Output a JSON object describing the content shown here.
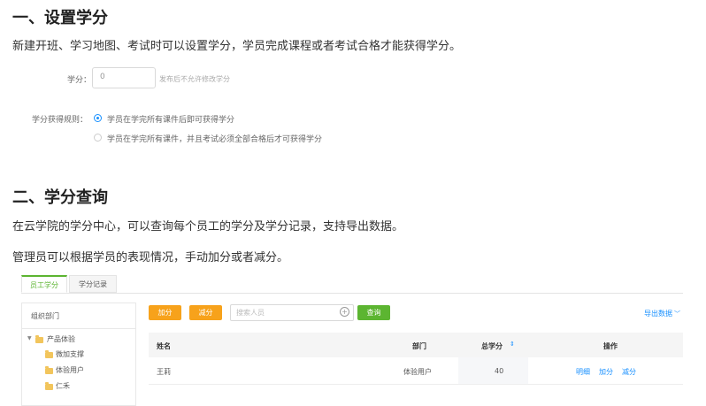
{
  "section1": {
    "title": "一、设置学分",
    "desc": "新建开班、学习地图、考试时可以设置学分，学员完成课程或者考试合格才能获得学分。",
    "credit_label": "学分：",
    "credit_value": "0",
    "credit_hint": "发布后不允许修改学分",
    "rule_label": "学分获得规则：",
    "rule_options": [
      "学员在学完所有课件后即可获得学分",
      "学员在学完所有课件，并且考试必须全部合格后才可获得学分"
    ]
  },
  "section2": {
    "title": "二、学分查询",
    "desc1": "在云学院的学分中心，可以查询每个员工的学分及学分记录，支持导出数据。",
    "desc2": "管理员可以根据学员的表现情况，手动加分或者减分。"
  },
  "app": {
    "tabs": [
      "员工学分",
      "学分记录"
    ],
    "sidebar_title": "组织部门",
    "tree": [
      "产品体验",
      "微加支撑",
      "体验用户",
      "仁禾"
    ],
    "add_btn": "加分",
    "sub_btn": "减分",
    "search_placeholder": "搜索人员",
    "query_btn": "查询",
    "export": "导出数据",
    "columns": [
      "姓名",
      "部门",
      "总学分",
      "操作"
    ],
    "rows": [
      {
        "name": "王莉",
        "dept": "体验用户",
        "total": "40",
        "actions": [
          "明细",
          "加分",
          "减分"
        ]
      }
    ]
  },
  "colors": {
    "accent": "#1890ff",
    "orange": "#f7a21b",
    "green": "#5cb531",
    "tab_active": "#5cb531"
  }
}
